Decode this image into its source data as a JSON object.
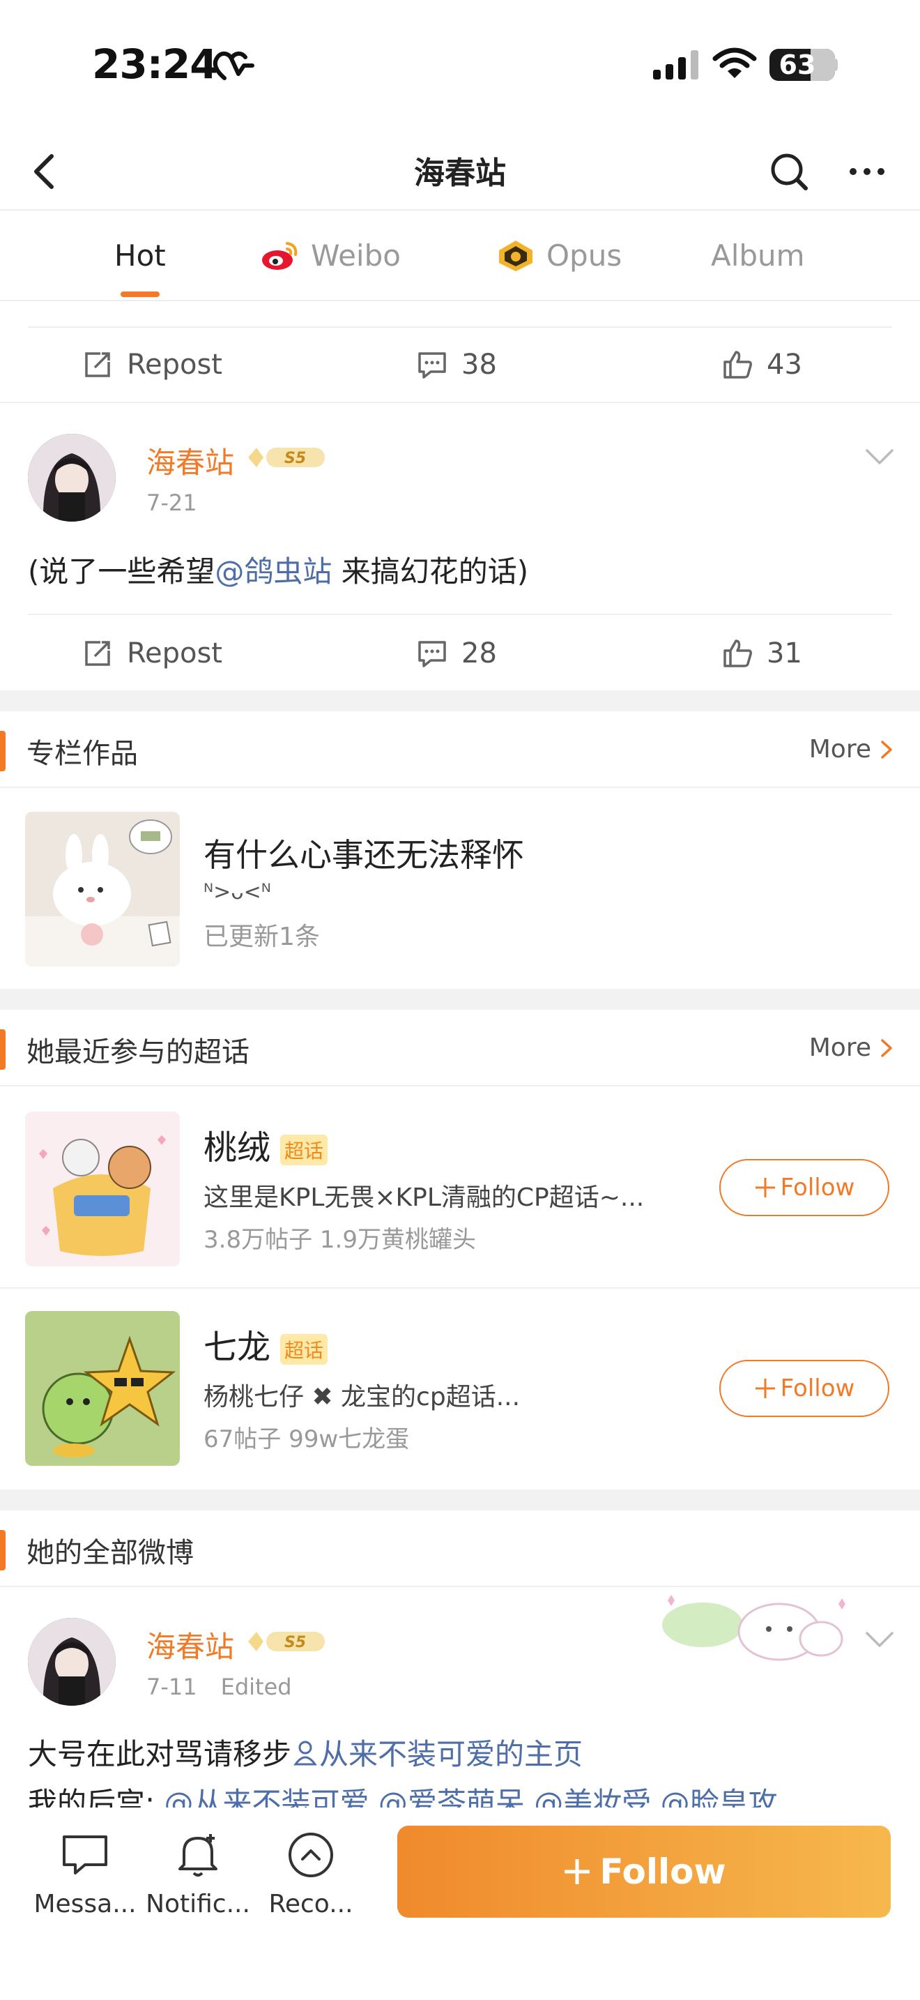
{
  "status_bar": {
    "time": "23:24",
    "battery": "63",
    "battery_level": 0.63
  },
  "nav": {
    "title": "海春站"
  },
  "tabs": [
    {
      "label": "Hot",
      "active": true
    },
    {
      "label": "Weibo",
      "active": false
    },
    {
      "label": "Opus",
      "active": false
    },
    {
      "label": "Album",
      "active": false
    }
  ],
  "post_prev_actions": {
    "repost": "Repost",
    "comments": "38",
    "likes": "43"
  },
  "post1": {
    "username": "海春站",
    "badge": "S5",
    "time": "7-21",
    "text_before": "(说了一些希望",
    "mention": "@鸽虫站",
    "text_after": " 来搞幻花的话)",
    "actions": {
      "repost": "Repost",
      "comments": "28",
      "likes": "31"
    }
  },
  "column_section": {
    "title": "专栏作品",
    "more": "More",
    "item": {
      "title": "有什么心事还无法释怀",
      "subtitle": "ᴺ>ᴗ<ᴺ",
      "meta": "已更新1条"
    }
  },
  "supertopic_section": {
    "title": "她最近参与的超话",
    "more": "More",
    "items": [
      {
        "name": "桃绒",
        "tag": "超话",
        "desc": "这里是KPL无畏×KPL清融的CP超话~...",
        "stats": "3.8万帖子 1.9万黄桃罐头",
        "follow": "Follow"
      },
      {
        "name": "七龙",
        "tag": "超话",
        "desc": "杨桃七仔 ✖ 龙宝的cp超话...",
        "stats": "67帖子 99w七龙蛋",
        "follow": "Follow"
      }
    ]
  },
  "all_weibo_section": {
    "title": "她的全部微博",
    "post": {
      "username": "海春站",
      "badge": "S5",
      "time": "7-11",
      "edited": "Edited",
      "line1_before": "大号在此对骂请移步",
      "line1_link": "从来不装可爱的主页",
      "line2_prefix": "我的后宫:",
      "line2_mentions": "@从来不装可爱 @爱苓萌呆 @美妆受 @脸皇攻"
    }
  },
  "bottom_bar": {
    "messages": "Messa...",
    "notifications": "Notific...",
    "recommend": "Reco...",
    "follow": "Follow"
  },
  "colors": {
    "accent": "#f27a26",
    "mention": "#4e6ea8",
    "username": "#f27a26"
  }
}
